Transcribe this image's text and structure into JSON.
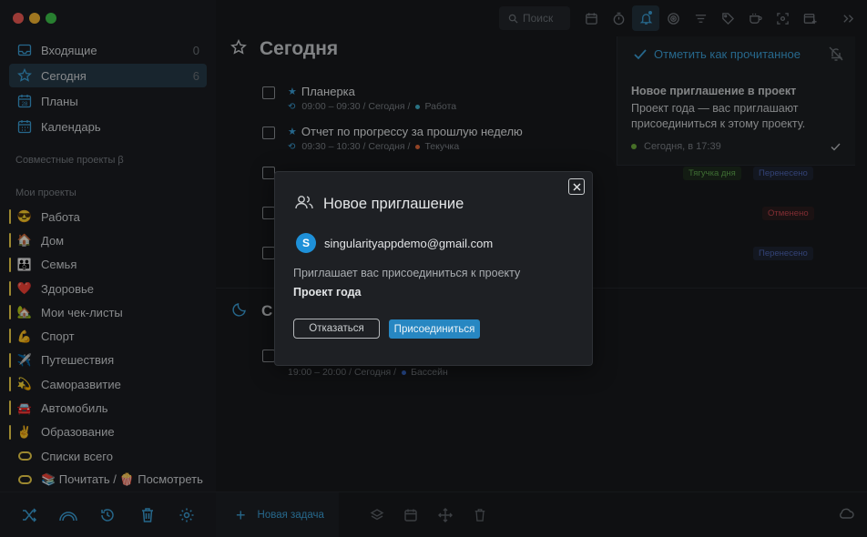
{
  "sidebar": {
    "nav": [
      {
        "label": "Входящие",
        "count": "0",
        "icon": "inbox-icon"
      },
      {
        "label": "Сегодня",
        "count": "6",
        "icon": "star-icon",
        "active": true
      },
      {
        "label": "Планы",
        "count": "",
        "icon": "calendar-28-icon"
      },
      {
        "label": "Календарь",
        "count": "",
        "icon": "calendar-grid-icon"
      }
    ],
    "shared_title": "Совместные проекты β",
    "my_projects_title": "Мои проекты",
    "projects": [
      {
        "emoji": "😎",
        "label": "Работа"
      },
      {
        "emoji": "🏠",
        "label": "Дом"
      },
      {
        "emoji": "👪",
        "label": "Семья"
      },
      {
        "emoji": "❤️",
        "label": "Здоровье"
      },
      {
        "emoji": "🏡",
        "label": "Мои чек-листы"
      },
      {
        "emoji": "💪",
        "label": "Спорт"
      },
      {
        "emoji": "✈️",
        "label": "Путешествия"
      },
      {
        "emoji": "💫",
        "label": "Саморазвитие"
      },
      {
        "emoji": "🚘",
        "label": "Автомобиль"
      },
      {
        "emoji": "✌️",
        "label": "Образование"
      },
      {
        "emoji": "",
        "label": "Списки всего"
      },
      {
        "emoji": "",
        "label": "📚 Почитать / 🍿 Посмотреть"
      }
    ],
    "footer_icons": [
      "shuffle-icon",
      "rainbow-icon",
      "history-icon",
      "trash-icon",
      "settings-icon"
    ]
  },
  "toolbar": {
    "search_placeholder": "Поиск",
    "icons": [
      "calendar-icon",
      "timer-icon",
      "bell-icon",
      "target-icon",
      "filter-icon",
      "tag-icon",
      "coffee-icon",
      "focus-icon",
      "add-window-icon",
      "collapse-icon"
    ]
  },
  "main": {
    "title": "Сегодня",
    "tasks": [
      {
        "title": "Планерка",
        "meta": "09:00 – 09:30 / Сегодня  /",
        "project": "Работа",
        "dot": "#3fb0c9",
        "starred": true
      },
      {
        "title": "Отчет по прогрессу за прошлую неделю",
        "meta": "09:30 – 10:30 / Сегодня  /",
        "project": "Текучка",
        "dot": "#e0683a",
        "starred": true
      }
    ],
    "evening_title": "С",
    "evening_task_meta": "19:00 – 20:00 / Сегодня  /",
    "evening_task_project": "Бассейн",
    "tags": [
      "Тягучка дня",
      "Перенесено",
      "Отменено",
      "Перенесено"
    ]
  },
  "notification": {
    "mark_read": "Отметить как прочитанное",
    "title": "Новое приглашение в проект",
    "body": "Проект года — вас приглашают присоединиться к этому проекту.",
    "time": "Сегодня, в 17:39"
  },
  "modal": {
    "title": "Новое приглашение",
    "avatar_letter": "S",
    "email": "singularityappdemo@gmail.com",
    "invite_text": "Приглашает вас присоединиться к проекту",
    "project_name": "Проект года",
    "decline_label": "Отказаться",
    "join_label": "Присоединиться"
  },
  "bottombar": {
    "new_task_label": "Новая задача"
  },
  "colors": {
    "accent": "#3b9fd6",
    "join_button": "#2787c2",
    "project_bar": "#f0d24a"
  }
}
